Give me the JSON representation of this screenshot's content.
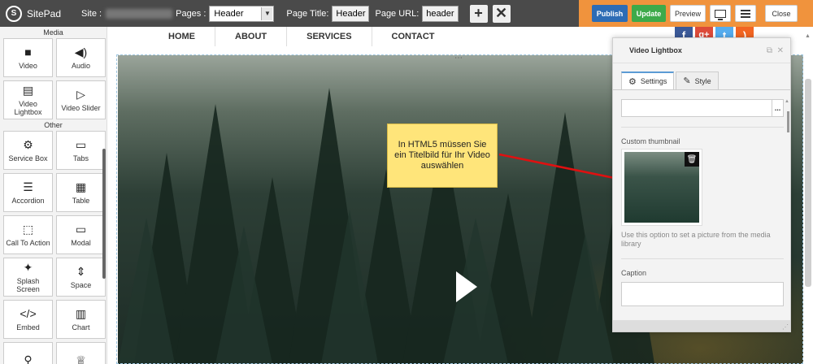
{
  "topbar": {
    "app_name": "SitePad",
    "site_label": "Site :",
    "pages_label": "Pages :",
    "pages_selected": "Header",
    "page_title_label": "Page Title:",
    "page_title_value": "Header",
    "page_url_label": "Page URL:",
    "page_url_value": "header",
    "add_icon": "plus-icon",
    "remove_icon": "x-icon"
  },
  "actions": {
    "publish": "Publish",
    "update": "Update",
    "preview": "Preview",
    "close": "Close",
    "colors": {
      "bar": "#f0933d",
      "publish": "#2d6cb5",
      "update": "#3daa4a"
    }
  },
  "sidebar": {
    "sections": [
      {
        "title": "Media",
        "items": [
          {
            "label": "Video",
            "icon": "video-camera-icon",
            "glyph": "■"
          },
          {
            "label": "Audio",
            "icon": "speaker-icon",
            "glyph": "◀)"
          },
          {
            "label": "Video Lightbox",
            "icon": "film-icon",
            "glyph": "▤"
          },
          {
            "label": "Video Slider",
            "icon": "video-slider-icon",
            "glyph": "▷"
          }
        ]
      },
      {
        "title": "Other",
        "items": [
          {
            "label": "Service Box",
            "icon": "gear-icon",
            "glyph": "⚙"
          },
          {
            "label": "Tabs",
            "icon": "tabs-icon",
            "glyph": "▭"
          },
          {
            "label": "Accordion",
            "icon": "accordion-icon",
            "glyph": "☰"
          },
          {
            "label": "Table",
            "icon": "table-icon",
            "glyph": "▦"
          },
          {
            "label": "Call To Action",
            "icon": "pointer-icon",
            "glyph": "⬚"
          },
          {
            "label": "Modal",
            "icon": "modal-icon",
            "glyph": "▭"
          },
          {
            "label": "Splash Screen",
            "icon": "splash-icon",
            "glyph": "✦"
          },
          {
            "label": "Space",
            "icon": "space-icon",
            "glyph": "⇕"
          },
          {
            "label": "Embed",
            "icon": "code-icon",
            "glyph": "</>"
          },
          {
            "label": "Chart",
            "icon": "bar-chart-icon",
            "glyph": "▥"
          },
          {
            "label": "",
            "icon": "map-icon",
            "glyph": "⚲"
          },
          {
            "label": "",
            "icon": "trophy-icon",
            "glyph": "♕"
          }
        ]
      }
    ]
  },
  "nav": {
    "items": [
      "HOME",
      "ABOUT",
      "SERVICES",
      "CONTACT"
    ]
  },
  "social": [
    {
      "icon": "facebook-icon",
      "glyph": "f",
      "color": "#3b5998"
    },
    {
      "icon": "google-plus-icon",
      "glyph": "g+",
      "color": "#dd4b39"
    },
    {
      "icon": "twitter-icon",
      "glyph": "t",
      "color": "#55acee"
    },
    {
      "icon": "rss-icon",
      "glyph": ")",
      "color": "#f26522"
    }
  ],
  "tooltip": {
    "text": "In HTML5 müssen Sie ein Titelbild für Ihr Video auswählen"
  },
  "panel": {
    "title": "Video Lightbox",
    "tabs": [
      {
        "label": "Settings",
        "icon": "gear-icon",
        "active": true
      },
      {
        "label": "Style",
        "icon": "brush-icon",
        "active": false
      }
    ],
    "source_button": "...",
    "custom_thumbnail_label": "Custom thumbnail",
    "help_text": "Use this option to set a picture from the media library",
    "caption_label": "Caption"
  }
}
